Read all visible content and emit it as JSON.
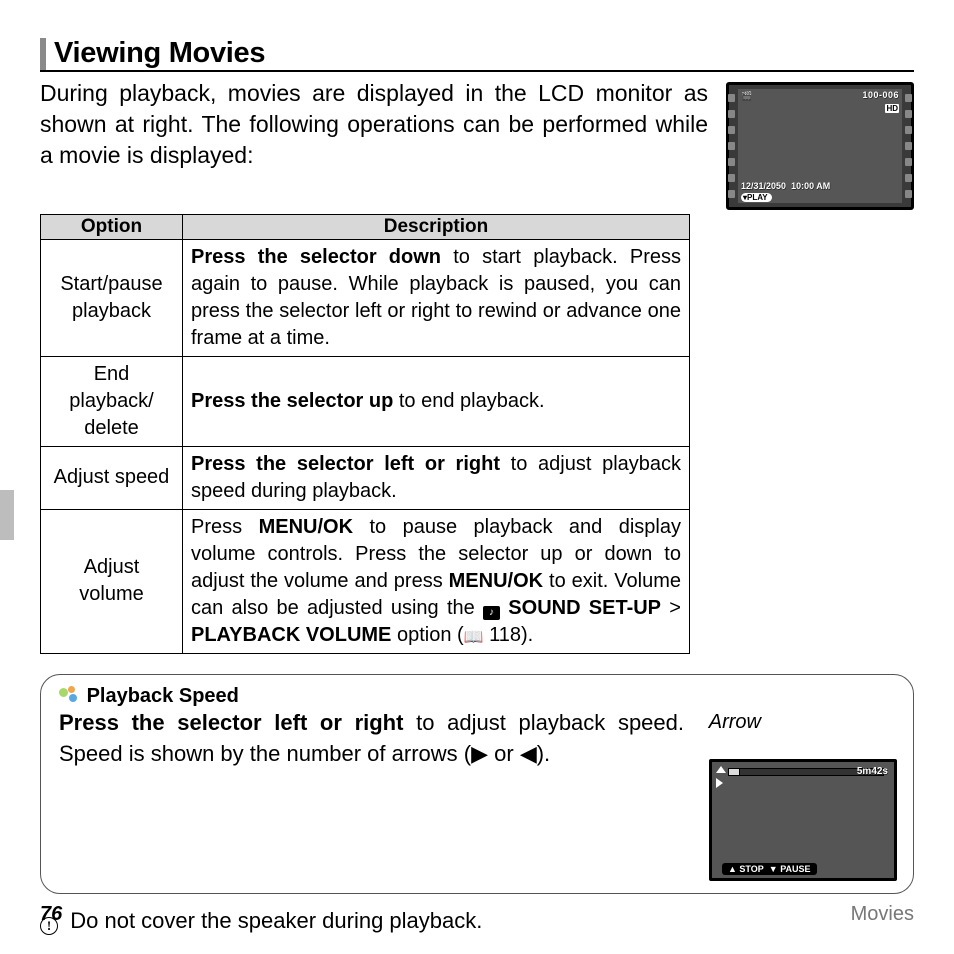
{
  "heading": "Viewing Movies",
  "intro": "During playback, movies are displayed in the LCD monitor as shown at right.  The following operations can be performed while a movie is displayed:",
  "lcd_main": {
    "frame_no": "100-006",
    "hd": "HD",
    "date": "12/31/2050",
    "time": "10:00 AM",
    "play": "PLAY"
  },
  "table": {
    "headers": {
      "option": "Option",
      "description": "Description"
    },
    "rows": [
      {
        "option": "Start/pause playback",
        "desc_bold": "Press the selector down",
        "desc_rest": " to start playback.  Press again to pause.  While playback is paused, you can press the selector left or right to rewind or advance one frame at a time."
      },
      {
        "option": "End playback/ delete",
        "desc_bold": "Press the selector up",
        "desc_rest": " to end playback."
      },
      {
        "option": "Adjust speed",
        "desc_bold": "Press the selector left or right",
        "desc_rest": " to adjust playback speed during playback."
      },
      {
        "option": "Adjust volume",
        "desc_pre": "Press ",
        "desc_bold1": "MENU/OK",
        "desc_mid1": " to pause playback and display volume controls.  Press the selector up or down to adjust the volume and press ",
        "desc_bold2": "MENU/OK",
        "desc_mid2": " to exit.  Volume can also be adjusted using the ",
        "desc_bold3": "SOUND SET-UP",
        "desc_gt": " > ",
        "desc_bold4": "PLAYBACK VOLUME",
        "desc_end": " option (",
        "desc_page": " 118)."
      }
    ]
  },
  "speed_box": {
    "title": "Playback Speed",
    "body_bold": "Press the selector left or right",
    "body_rest": " to adjust playback speed.  Speed is shown by the number of arrows (",
    "arrow_r": "▶",
    "body_or": " or ",
    "arrow_l": "◀",
    "body_close": ").",
    "arrow_label": "Arrow",
    "lcd_time": "5m42s",
    "stop": "STOP",
    "pause": "PAUSE"
  },
  "warning": "Do not cover the speaker during playback.",
  "footer": {
    "page": "76",
    "section": "Movies"
  }
}
